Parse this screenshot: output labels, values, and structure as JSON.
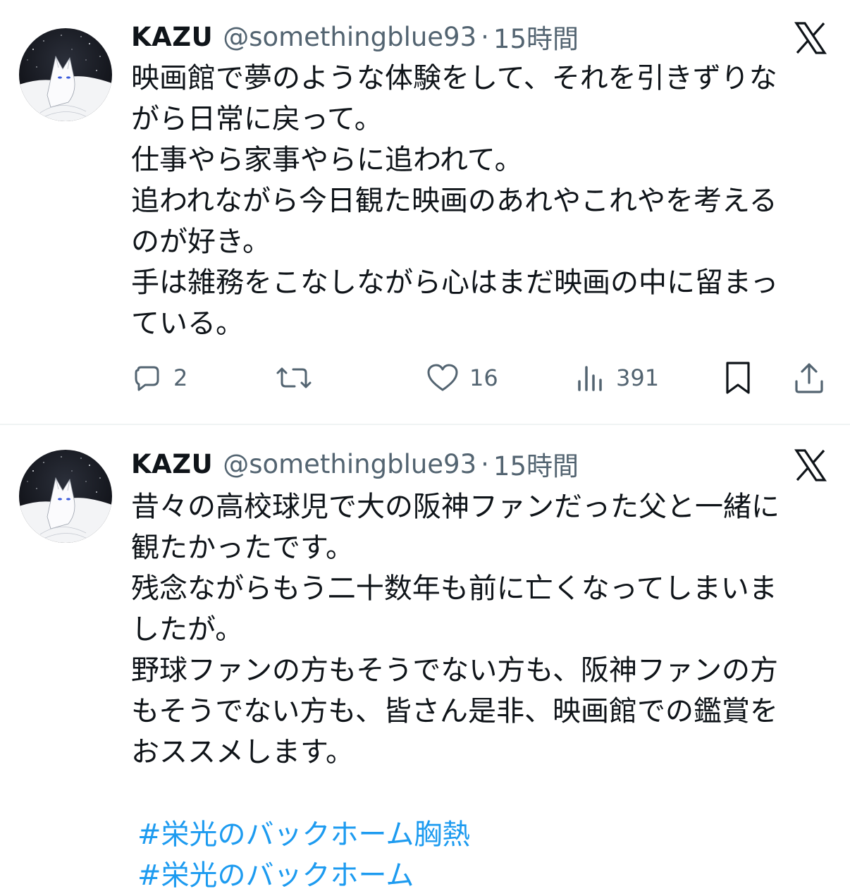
{
  "tweets": [
    {
      "author": {
        "name": "KAZU",
        "handle": "@somethingblue93",
        "separator": "·",
        "time": "15時間"
      },
      "text": "映画館で夢のような体験をして、それを引きずりな\nがら日常に戻って。\n仕事やら家事やらに追われて。\n追われながら今日観た映画のあれやこれやを考える\nのが好き。\n手は雑務をこなしながら心はまだ映画の中に留まっ\nている。",
      "actions": {
        "replies": "2",
        "likes": "16",
        "views": "391"
      }
    },
    {
      "author": {
        "name": "KAZU",
        "handle": "@somethingblue93",
        "separator": "·",
        "time": "15時間"
      },
      "text": "昔々の高校球児で大の阪神ファンだった父と一緒に\n観たかったです。\n残念ながらもう二十数年も前に亡くなってしまいま\nしたが。\n野球ファンの方もそうでない方も、阪神ファンの方\nもそうでない方も、皆さん是非、映画館での鑑賞を\nおススメします。",
      "hashtags": [
        "#栄光のバックホーム胸熱",
        "#栄光のバックホーム"
      ]
    }
  ],
  "icons": {
    "avatar": "white-fox-avatar",
    "platform": "x-logo-icon",
    "reply": "speech-bubble-icon",
    "retweet": "retweet-arrows-icon",
    "like": "heart-icon",
    "views": "bar-chart-icon",
    "bookmark": "bookmark-icon",
    "share": "share-upload-icon"
  },
  "colors": {
    "text": "#0f1419",
    "secondary": "#536471",
    "link": "#1d9bf0",
    "divider": "#eff3f4"
  }
}
